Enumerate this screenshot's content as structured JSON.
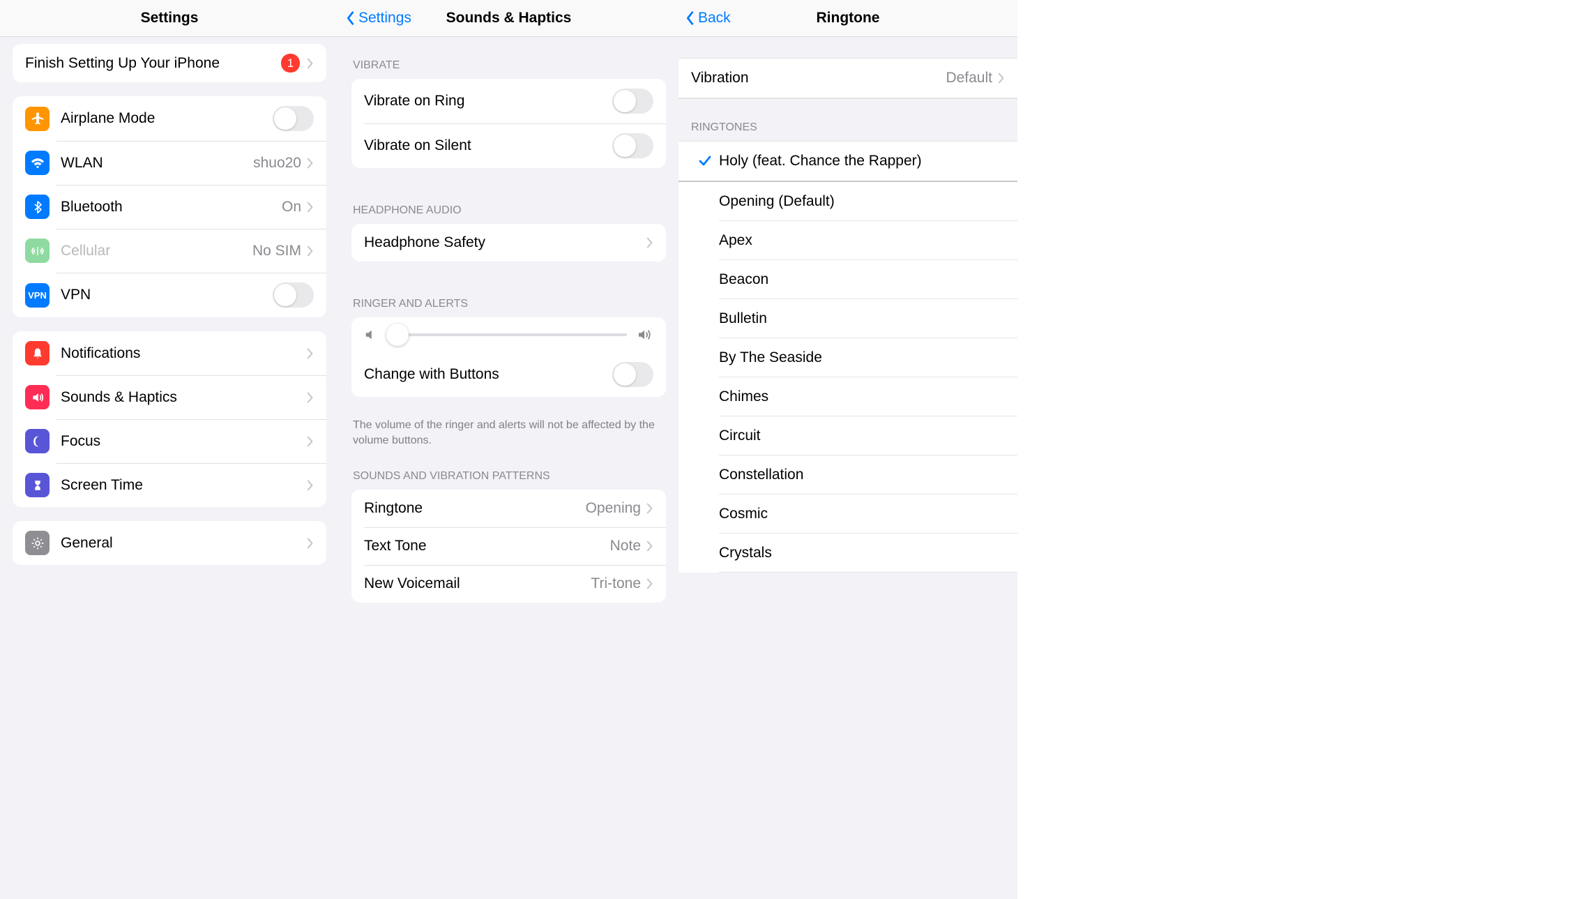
{
  "panel1": {
    "title": "Settings",
    "finishSetup": {
      "label": "Finish Setting Up Your iPhone",
      "badge": "1"
    },
    "group1": [
      {
        "name": "airplane-mode",
        "label": "Airplane Mode",
        "type": "toggle",
        "iconBg": "#ff9500"
      },
      {
        "name": "wlan",
        "label": "WLAN",
        "detail": "shuo20",
        "type": "chevron",
        "iconBg": "#007aff"
      },
      {
        "name": "bluetooth",
        "label": "Bluetooth",
        "detail": "On",
        "type": "chevron",
        "iconBg": "#007aff"
      },
      {
        "name": "cellular",
        "label": "Cellular",
        "detail": "No SIM",
        "type": "chevron",
        "iconBg": "#8fdaa0",
        "muted": true
      },
      {
        "name": "vpn",
        "label": "VPN",
        "type": "toggle",
        "iconBg": "#007aff"
      }
    ],
    "group2": [
      {
        "name": "notifications",
        "label": "Notifications",
        "iconBg": "#ff3b30"
      },
      {
        "name": "sounds-haptics",
        "label": "Sounds & Haptics",
        "iconBg": "#ff2d55"
      },
      {
        "name": "focus",
        "label": "Focus",
        "iconBg": "#5856d6"
      },
      {
        "name": "screen-time",
        "label": "Screen Time",
        "iconBg": "#5856d6"
      }
    ],
    "group3": [
      {
        "name": "general",
        "label": "General",
        "iconBg": "#8e8e93"
      }
    ]
  },
  "panel2": {
    "back": "Settings",
    "title": "Sounds & Haptics",
    "sections": {
      "vibrate": {
        "header": "VIBRATE",
        "rows": [
          {
            "name": "vibrate-on-ring",
            "label": "Vibrate on Ring",
            "type": "toggle"
          },
          {
            "name": "vibrate-on-silent",
            "label": "Vibrate on Silent",
            "type": "toggle"
          }
        ]
      },
      "headphone": {
        "header": "HEADPHONE AUDIO",
        "rows": [
          {
            "name": "headphone-safety",
            "label": "Headphone Safety",
            "type": "chevron"
          }
        ]
      },
      "ringer": {
        "header": "RINGER AND ALERTS",
        "changeButtons": {
          "label": "Change with Buttons"
        },
        "footer": "The volume of the ringer and alerts will not be affected by the volume buttons."
      },
      "sounds": {
        "header": "SOUNDS AND VIBRATION PATTERNS",
        "rows": [
          {
            "name": "ringtone",
            "label": "Ringtone",
            "detail": "Opening"
          },
          {
            "name": "text-tone",
            "label": "Text Tone",
            "detail": "Note"
          },
          {
            "name": "new-voicemail",
            "label": "New Voicemail",
            "detail": "Tri-tone"
          }
        ]
      }
    }
  },
  "panel3": {
    "back": "Back",
    "title": "Ringtone",
    "vibration": {
      "label": "Vibration",
      "detail": "Default"
    },
    "ringtonesHeader": "RINGTONES",
    "selected": "Holy (feat. Chance the Rapper)",
    "ringtones": [
      "Opening (Default)",
      "Apex",
      "Beacon",
      "Bulletin",
      "By The Seaside",
      "Chimes",
      "Circuit",
      "Constellation",
      "Cosmic",
      "Crystals"
    ]
  }
}
